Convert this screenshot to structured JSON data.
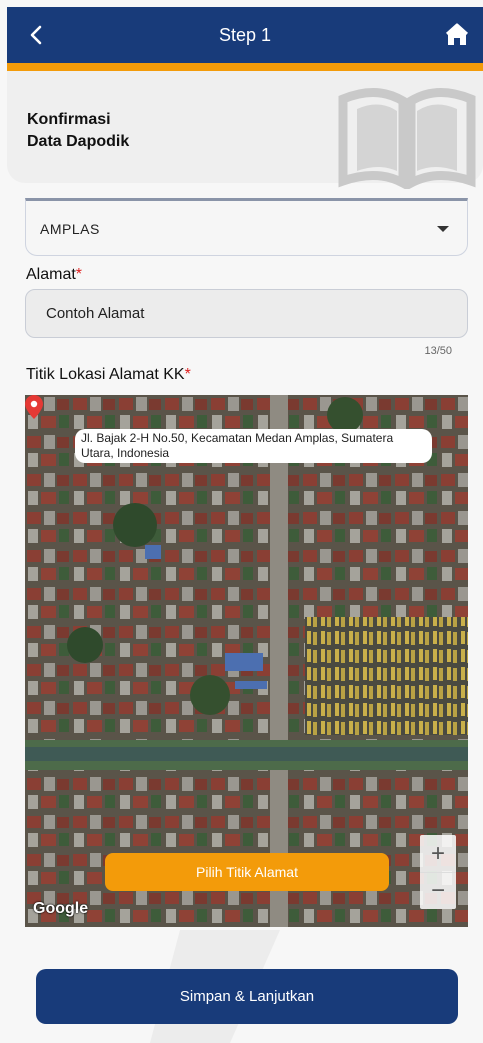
{
  "appbar": {
    "title": "Step 1"
  },
  "header": {
    "line1": "Konfirmasi",
    "line2": "Data Dapodik"
  },
  "form": {
    "kecamatan": {
      "value": "AMPLAS"
    },
    "alamat": {
      "label": "Alamat",
      "required_mark": "*",
      "value": "Contoh Alamat",
      "counter": "13/50"
    },
    "lokasi": {
      "label": "Titik Lokasi Alamat KK",
      "required_mark": "*"
    }
  },
  "map": {
    "address": "Jl. Bajak 2-H No.50, Kecamatan Medan Amplas, Sumatera Utara, Indonesia",
    "pick_button": "Pilih Titik Alamat",
    "zoom_in": "+",
    "zoom_out": "−",
    "provider": "Google"
  },
  "footer": {
    "submit_label": "Simpan & Lanjutkan"
  },
  "colors": {
    "primary": "#183b7a",
    "accent": "#f39b0a",
    "required": "#e02020"
  }
}
